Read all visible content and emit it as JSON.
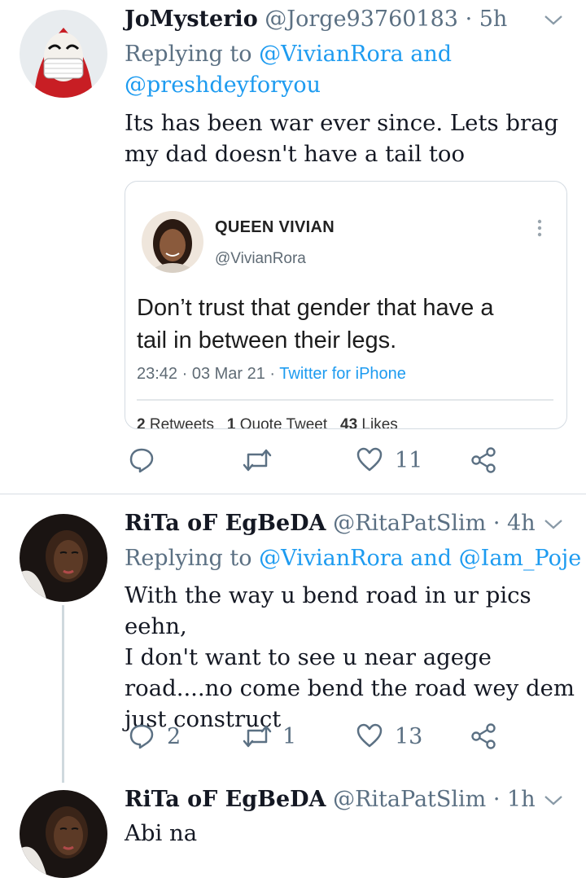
{
  "tweets": [
    {
      "name": "JoMysterio",
      "handle": "@Jorge93760183",
      "time": "· 5h",
      "replying_label": "Replying to",
      "replying_mentions_1": "@VivianRora",
      "replying_and": "and",
      "replying_mentions_2": "@preshdeyforyou",
      "text_line1": "Its has been war ever since. Lets brag",
      "text_line2": "my dad doesn't have a tail too",
      "actions": {
        "reply_count": "",
        "retweet_count": "",
        "like_count": "11"
      }
    },
    {
      "name": "RiTa oF EgBeDA",
      "handle": "@RitaPatSlim",
      "time": "· 4h",
      "replying_label": "Replying to",
      "replying_mentions_1": "@VivianRora",
      "replying_and": "and",
      "replying_mentions_2": "@Iam_Poje",
      "text_lines": [
        "With the way u bend road in ur pics eehn,",
        "I don't want to see u near agege",
        "road....no come bend the road wey dem",
        "just construct"
      ],
      "actions": {
        "reply_count": "2",
        "retweet_count": "1",
        "like_count": "13"
      }
    },
    {
      "name": "RiTa oF EgBeDA",
      "handle": "@RitaPatSlim",
      "time": "· 1h",
      "text": "Abi na"
    }
  ],
  "quoted": {
    "name": "QUEEN VIVIAN",
    "handle": "@VivianRora",
    "text_line1": "Don’t trust that gender that have a",
    "text_line2": "tail in between their legs.",
    "date": "23:42 · 03 Mar 21 ·",
    "source": "Twitter for iPhone",
    "retweets": "2",
    "retweets_label": "Retweets",
    "quote_tweets": "1",
    "quote_tweets_label": "Quote Tweet",
    "likes": "43",
    "likes_label": "Likes"
  },
  "colors": {
    "accent": "#1d9bf0",
    "muted": "#5b7083",
    "text": "#141823"
  }
}
